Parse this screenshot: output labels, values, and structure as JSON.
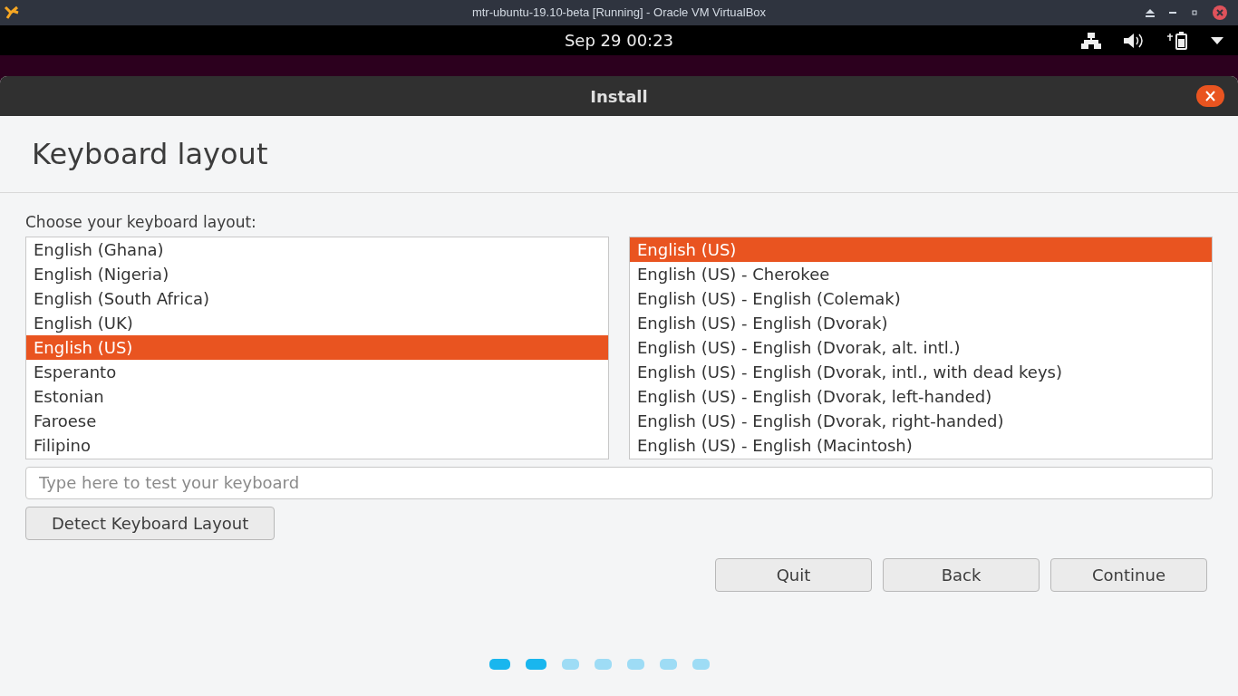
{
  "host_window": {
    "title": "mtr-ubuntu-19.10-beta [Running] - Oracle VM VirtualBox"
  },
  "top_bar": {
    "clock": "Sep 29  00:23"
  },
  "installer": {
    "title": "Install",
    "heading": "Keyboard layout",
    "prompt": "Choose your keyboard layout:",
    "layouts": [
      {
        "label": "English (Ghana)",
        "selected": false
      },
      {
        "label": "English (Nigeria)",
        "selected": false
      },
      {
        "label": "English (South Africa)",
        "selected": false
      },
      {
        "label": "English (UK)",
        "selected": false
      },
      {
        "label": "English (US)",
        "selected": true
      },
      {
        "label": "Esperanto",
        "selected": false
      },
      {
        "label": "Estonian",
        "selected": false
      },
      {
        "label": "Faroese",
        "selected": false
      },
      {
        "label": "Filipino",
        "selected": false
      }
    ],
    "variants": [
      {
        "label": "English (US)",
        "selected": true
      },
      {
        "label": "English (US) - Cherokee",
        "selected": false
      },
      {
        "label": "English (US) - English (Colemak)",
        "selected": false
      },
      {
        "label": "English (US) - English (Dvorak)",
        "selected": false
      },
      {
        "label": "English (US) - English (Dvorak, alt. intl.)",
        "selected": false
      },
      {
        "label": "English (US) - English (Dvorak, intl., with dead keys)",
        "selected": false
      },
      {
        "label": "English (US) - English (Dvorak, left-handed)",
        "selected": false
      },
      {
        "label": "English (US) - English (Dvorak, right-handed)",
        "selected": false
      },
      {
        "label": "English (US) - English (Macintosh)",
        "selected": false
      }
    ],
    "test_field": {
      "placeholder": "Type here to test your keyboard"
    },
    "detect_button": "Detect Keyboard Layout",
    "buttons": [
      "Quit",
      "Back",
      "Continue"
    ],
    "steps": [
      {
        "done": true
      },
      {
        "done": true
      },
      {
        "done": false
      },
      {
        "done": false
      },
      {
        "done": false
      },
      {
        "done": false
      },
      {
        "done": false
      }
    ]
  }
}
